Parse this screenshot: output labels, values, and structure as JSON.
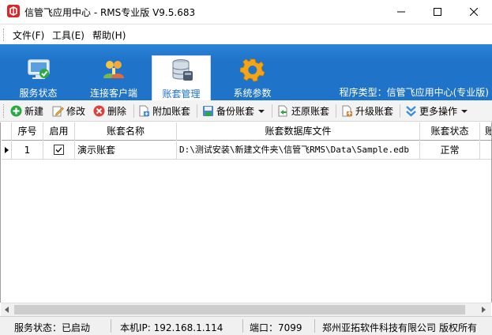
{
  "window": {
    "title": "信管飞应用中心 - RMS专业版 V9.5.683",
    "minimize_icon": "minimize-icon",
    "maximize_icon": "maximize-icon",
    "close_icon": "close-icon"
  },
  "menu": {
    "items": [
      {
        "label": "文件(F)"
      },
      {
        "label": "工具(E)"
      },
      {
        "label": "帮助(H)"
      }
    ]
  },
  "nav": {
    "tabs": [
      {
        "label": "服务状态",
        "icon": "monitor-check-icon",
        "active": false
      },
      {
        "label": "连接客户端",
        "icon": "users-icon",
        "active": false
      },
      {
        "label": "账套管理",
        "icon": "database-icon",
        "active": true
      },
      {
        "label": "系统参数",
        "icon": "gear-icon",
        "active": false
      }
    ],
    "program_type": "程序类型：信管飞应用中心(专业版)",
    "colors": {
      "band": "#1f73c8",
      "active_text": "#1f73c8"
    }
  },
  "toolbar": {
    "new_label": "新建",
    "edit_label": "修改",
    "delete_label": "删除",
    "attach_label": "附加账套",
    "backup_label": "备份账套",
    "restore_label": "还原账套",
    "upgrade_label": "升级账套",
    "more_label": "更多操作"
  },
  "grid": {
    "columns": [
      "序号",
      "启用",
      "账套名称",
      "账套数据库文件",
      "账套状态",
      "账"
    ],
    "rows": [
      {
        "index": "1",
        "enabled": true,
        "name": "演示账套",
        "file": "D:\\测试安装\\新建文件夹\\信管飞RMS\\Data\\Sample.edb",
        "status": "正常"
      }
    ]
  },
  "statusbar": {
    "service": "服务状态：已启动",
    "ip": "本机IP: 192.168.1.114",
    "port": "端口：7099",
    "company": "郑州亚拓软件科技有限公司",
    "copyright": "版权所有"
  }
}
